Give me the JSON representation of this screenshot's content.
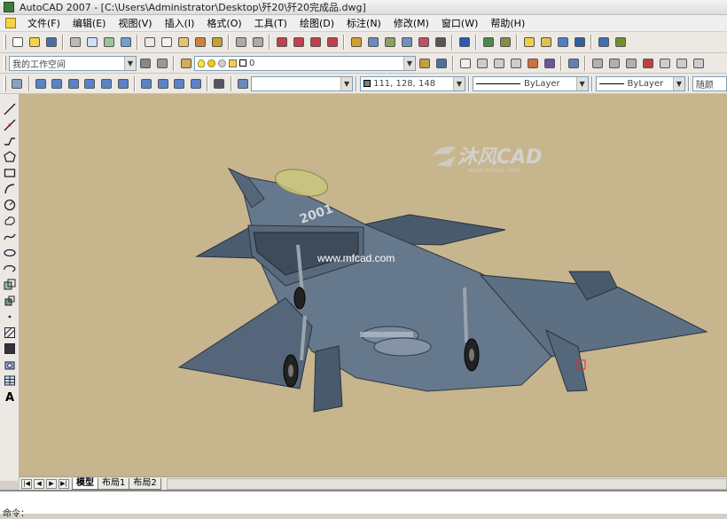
{
  "window": {
    "title": "AutoCAD 2007 - [C:\\Users\\Administrator\\Desktop\\歼20\\歼20完成品.dwg]"
  },
  "menu": [
    "文件(F)",
    "编辑(E)",
    "视图(V)",
    "插入(I)",
    "格式(O)",
    "工具(T)",
    "绘图(D)",
    "标注(N)",
    "修改(M)",
    "窗口(W)",
    "帮助(H)"
  ],
  "toolbars": {
    "workspace": "我的工作空间",
    "layer_value": "0",
    "color_value": "111, 128, 148",
    "linetype_value": "ByLayer",
    "lineweight_value": "ByLayer",
    "plotstyle_value": "随颜"
  },
  "viewport": {
    "background_color": "#c7b58e",
    "model_number": "2001",
    "watermark_brand": "沐风CAD",
    "watermark_small": "www.mfcad.com",
    "watermark_url": "www.mfcad.com"
  },
  "layout_tabs": [
    {
      "label": "模型",
      "active": true
    },
    {
      "label": "布局1",
      "active": false
    },
    {
      "label": "布局2",
      "active": false
    }
  ],
  "command_line": {
    "prompt": "命令："
  }
}
